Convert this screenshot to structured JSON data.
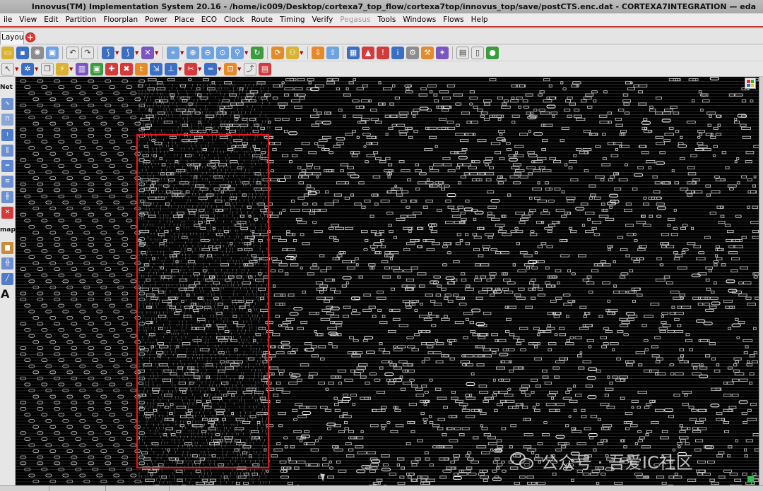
{
  "window": {
    "title": "Innovus(TM) Implementation System 20.16 - /home/ic009/Desktop/cortexa7_top_flow/cortexa7top/innovus_top/save/postCTS.enc.dat - CORTEXA7INTEGRATION — eda"
  },
  "menubar": {
    "items": [
      {
        "label": "ile",
        "enabled": true
      },
      {
        "label": "View",
        "enabled": true
      },
      {
        "label": "Edit",
        "enabled": true
      },
      {
        "label": "Partition",
        "enabled": true
      },
      {
        "label": "Floorplan",
        "enabled": true
      },
      {
        "label": "Power",
        "enabled": true
      },
      {
        "label": "Place",
        "enabled": true
      },
      {
        "label": "ECO",
        "enabled": true
      },
      {
        "label": "Clock",
        "enabled": true
      },
      {
        "label": "Route",
        "enabled": true
      },
      {
        "label": "Timing",
        "enabled": true
      },
      {
        "label": "Verify",
        "enabled": true
      },
      {
        "label": "Pegasus",
        "enabled": false
      },
      {
        "label": "Tools",
        "enabled": true
      },
      {
        "label": "Windows",
        "enabled": true
      },
      {
        "label": "Flows",
        "enabled": true
      },
      {
        "label": "Help",
        "enabled": true
      }
    ]
  },
  "tabs": {
    "active_label": "Layout",
    "add_symbol": "+"
  },
  "left_toolbar": {
    "net_label": "Net",
    "map_label": "map",
    "text_tool_label": "A"
  },
  "watermark": {
    "text": "公众号 · 吾爱IC社区"
  },
  "colors": {
    "accent_menu_underline": "#cc3333",
    "selection_box": "#e21818",
    "canvas_background": "#000000",
    "cell_outline": "#d0d0d0"
  }
}
